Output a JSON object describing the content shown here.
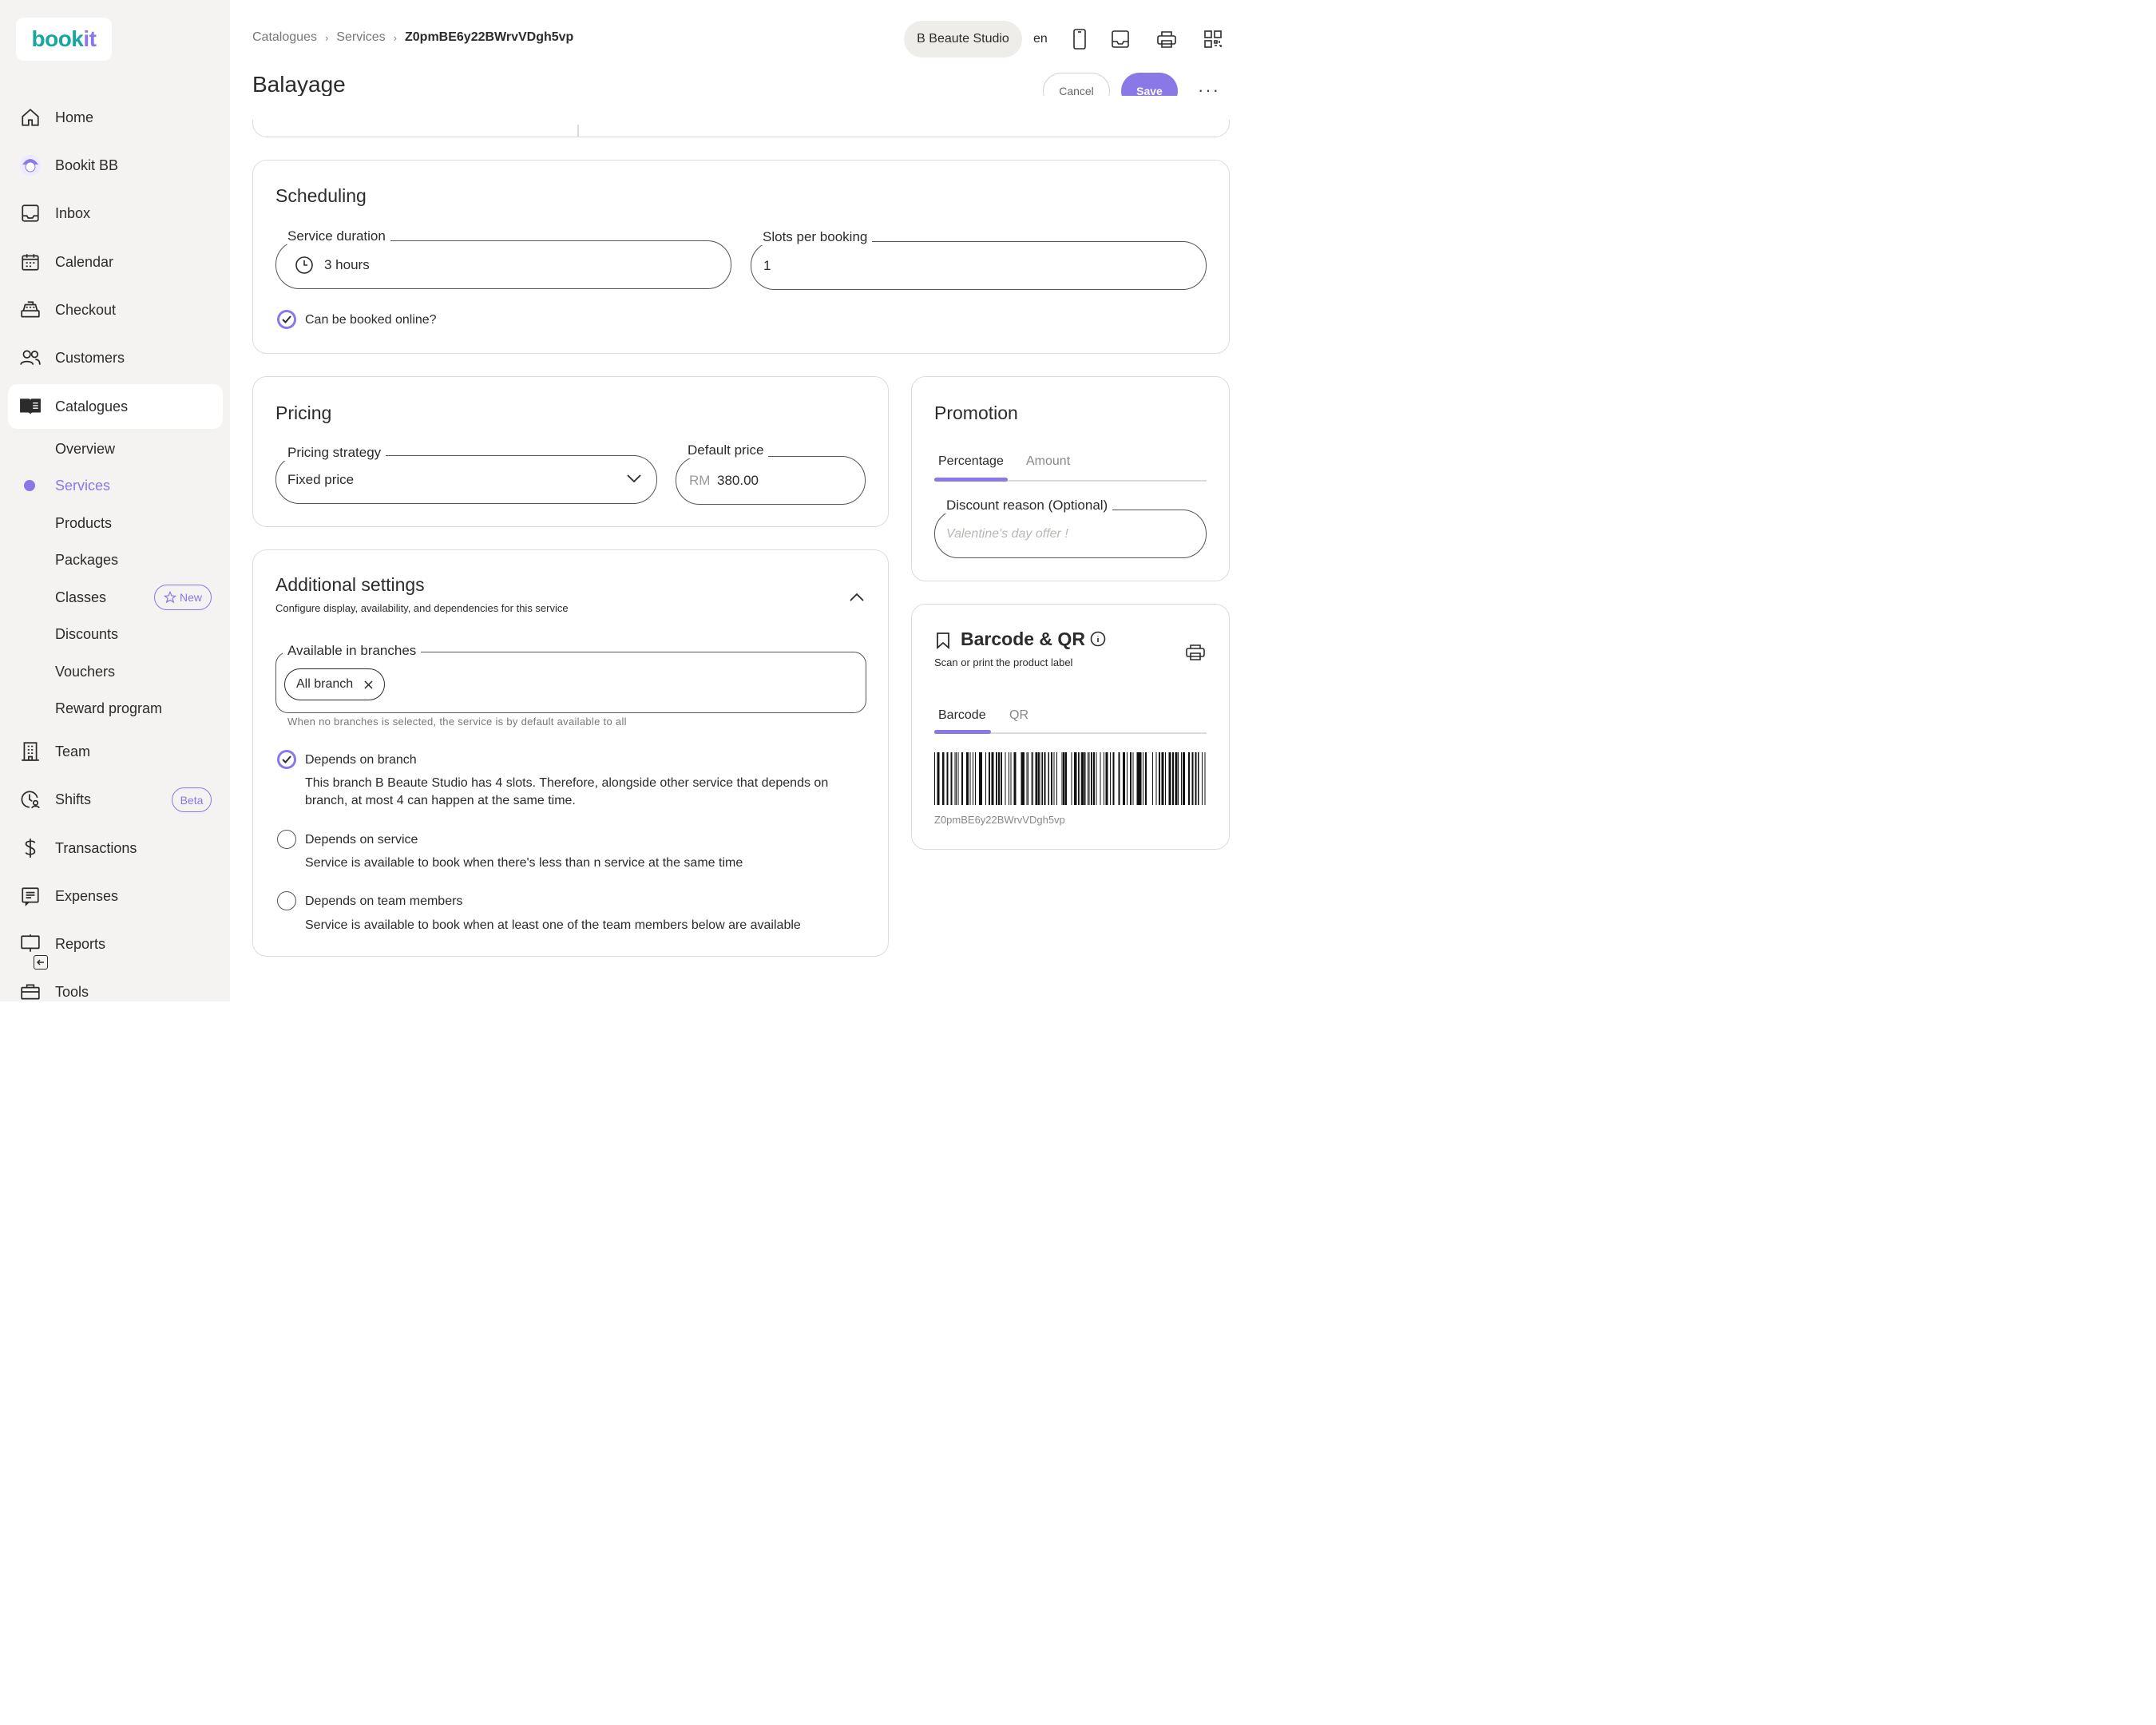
{
  "app": {
    "logo_part1": "book",
    "logo_part2": "it"
  },
  "sidebar": {
    "items": [
      {
        "label": "Home",
        "icon": "home-icon"
      },
      {
        "label": "Bookit BB",
        "icon": "avatar-icon"
      },
      {
        "label": "Inbox",
        "icon": "inbox-icon"
      },
      {
        "label": "Calendar",
        "icon": "calendar-icon"
      },
      {
        "label": "Checkout",
        "icon": "register-icon"
      },
      {
        "label": "Customers",
        "icon": "users-icon"
      },
      {
        "label": "Catalogues",
        "icon": "book-icon"
      },
      {
        "label": "Team",
        "icon": "building-icon"
      },
      {
        "label": "Shifts",
        "icon": "clock-user-icon",
        "badge": "Beta"
      },
      {
        "label": "Transactions",
        "icon": "dollar-icon"
      },
      {
        "label": "Expenses",
        "icon": "receipt-icon"
      },
      {
        "label": "Reports",
        "icon": "chart-icon"
      },
      {
        "label": "Tools",
        "icon": "toolbox-icon"
      }
    ],
    "catalogue_subitems": [
      {
        "label": "Overview"
      },
      {
        "label": "Services"
      },
      {
        "label": "Products"
      },
      {
        "label": "Packages"
      },
      {
        "label": "Classes",
        "badge": "New"
      },
      {
        "label": "Discounts"
      },
      {
        "label": "Vouchers"
      },
      {
        "label": "Reward program"
      }
    ],
    "accent": "#8a78e6"
  },
  "header": {
    "breadcrumb": [
      "Catalogues",
      "Services",
      "Z0pmBE6y22BWrvVDgh5vp"
    ],
    "breadcrumb_sep": "›",
    "title": "Balayage",
    "studio": "B Beaute Studio",
    "lang": "en",
    "cancel": "Cancel",
    "save": "Save",
    "more": "···"
  },
  "scheduling": {
    "title": "Scheduling",
    "duration_label": "Service duration",
    "duration_value": "3 hours",
    "slots_label": "Slots per booking",
    "slots_value": "1",
    "online_label": "Can be booked online?",
    "online_checked": true
  },
  "pricing": {
    "title": "Pricing",
    "strategy_label": "Pricing strategy",
    "strategy_value": "Fixed price",
    "price_label": "Default price",
    "currency": "RM",
    "price_value": "380.00"
  },
  "additional": {
    "title": "Additional settings",
    "subtitle": "Configure display, availability, and dependencies for this service",
    "branches_label": "Available in branches",
    "branch_chip": "All branch",
    "branches_help": "When no branches is selected, the service is by default available to all",
    "options": [
      {
        "label": "Depends on branch",
        "checked": true,
        "desc_line1": "This branch B Beaute Studio has 4 slots. Therefore, alongside other service that depends on",
        "desc_line2": "branch, at most 4 can happen at the same time."
      },
      {
        "label": "Depends on service",
        "checked": false,
        "desc_line1": "Service is available to book when there's less than n service at the same time"
      },
      {
        "label": "Depends on team members",
        "checked": false,
        "desc_line1": "Service is available to book when at least one of the team members below are available"
      }
    ]
  },
  "promotion": {
    "title": "Promotion",
    "tabs": [
      "Percentage",
      "Amount"
    ],
    "active_tab": "Percentage",
    "reason_label": "Discount reason (Optional)",
    "reason_placeholder": "Valentine's day offer !"
  },
  "barcode": {
    "title": "Barcode & QR",
    "subtitle": "Scan or print the product label",
    "tabs": [
      "Barcode",
      "QR"
    ],
    "active_tab": "Barcode",
    "code": "Z0pmBE6y22BWrvVDgh5vp"
  }
}
